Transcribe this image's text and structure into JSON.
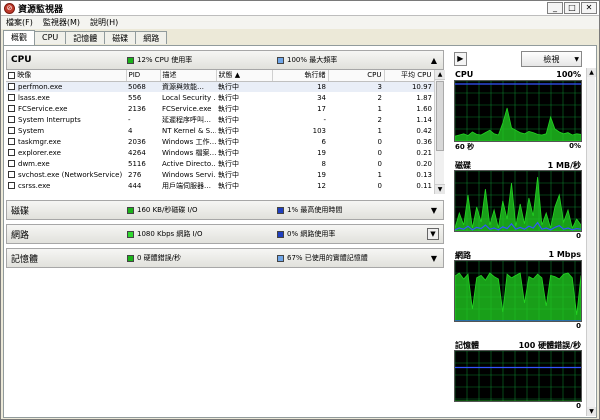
{
  "window": {
    "title": "資源監視器",
    "min": "_",
    "max": "□",
    "close": "✕"
  },
  "menu": [
    "檔案(F)",
    "監視器(M)",
    "說明(H)"
  ],
  "tabs": [
    {
      "label": "概觀",
      "active": true
    },
    {
      "label": "CPU",
      "active": false
    },
    {
      "label": "記憶體",
      "active": false
    },
    {
      "label": "磁碟",
      "active": false
    },
    {
      "label": "網路",
      "active": false
    }
  ],
  "cpu_section": {
    "title": "CPU",
    "stat1": "12% CPU 使用率",
    "stat2": "100% 最大頻率",
    "columns": [
      "映像",
      "PID",
      "描述",
      "狀態",
      "執行緒",
      "CPU",
      "平均 CPU"
    ],
    "rows": [
      {
        "name": "perfmon.exe",
        "pid": "5068",
        "desc": "資源與效能…",
        "status": "執行中",
        "threads": "18",
        "cpu": "3",
        "avg": "10.97"
      },
      {
        "name": "lsass.exe",
        "pid": "556",
        "desc": "Local Security …",
        "status": "執行中",
        "threads": "34",
        "cpu": "2",
        "avg": "1.87"
      },
      {
        "name": "FCService.exe",
        "pid": "2136",
        "desc": "FCService.exe",
        "status": "執行中",
        "threads": "17",
        "cpu": "1",
        "avg": "1.60"
      },
      {
        "name": "System Interrupts",
        "pid": "-",
        "desc": "延遲程序呼叫…",
        "status": "執行中",
        "threads": "-",
        "cpu": "2",
        "avg": "1.14"
      },
      {
        "name": "System",
        "pid": "4",
        "desc": "NT Kernel & S…",
        "status": "執行中",
        "threads": "103",
        "cpu": "1",
        "avg": "0.42"
      },
      {
        "name": "taskmgr.exe",
        "pid": "2036",
        "desc": "Windows 工作…",
        "status": "執行中",
        "threads": "6",
        "cpu": "0",
        "avg": "0.36"
      },
      {
        "name": "explorer.exe",
        "pid": "4264",
        "desc": "Windows 檔案…",
        "status": "執行中",
        "threads": "19",
        "cpu": "0",
        "avg": "0.21"
      },
      {
        "name": "dwm.exe",
        "pid": "5116",
        "desc": "Active Directo…",
        "status": "執行中",
        "threads": "8",
        "cpu": "0",
        "avg": "0.20"
      },
      {
        "name": "svchost.exe (NetworkService)",
        "pid": "276",
        "desc": "Windows Servi…",
        "status": "執行中",
        "threads": "19",
        "cpu": "1",
        "avg": "0.13"
      },
      {
        "name": "csrss.exe",
        "pid": "444",
        "desc": "用戶端伺服器…",
        "status": "執行中",
        "threads": "12",
        "cpu": "0",
        "avg": "0.11"
      }
    ]
  },
  "disk_section": {
    "title": "磁碟",
    "stat1": "160 KB/秒磁碟 I/O",
    "stat2": "1% 最高使用時間"
  },
  "network_section": {
    "title": "網路",
    "stat1": "1080 Kbps 網路 I/O",
    "stat2": "0% 網路使用率"
  },
  "memory_section": {
    "title": "記憶體",
    "stat1": "0 硬體錯誤/秒",
    "stat2": "67% 已使用的實體記憶體"
  },
  "right_panel": {
    "view_label": "檢視",
    "graphs": [
      {
        "name": "CPU",
        "max": "100%",
        "foot_left": "60 秒",
        "foot_right": "0%",
        "green": [
          8,
          10,
          12,
          9,
          15,
          11,
          10,
          14,
          18,
          12,
          10,
          30,
          55,
          22,
          18,
          14,
          12,
          16,
          14,
          11,
          10,
          12,
          40,
          20,
          15,
          12,
          14,
          10,
          12,
          11
        ],
        "blue": [
          95,
          95,
          95,
          95,
          95,
          95,
          95,
          95,
          95,
          95,
          95,
          95,
          95,
          95,
          95,
          95,
          95,
          95,
          95,
          95,
          95,
          95,
          95,
          95,
          95,
          95,
          95,
          95,
          95,
          95
        ]
      },
      {
        "name": "磁碟",
        "max": "1 MB/秒",
        "foot_left": "",
        "foot_right": "0",
        "green": [
          5,
          30,
          10,
          60,
          5,
          40,
          15,
          70,
          10,
          35,
          5,
          50,
          20,
          80,
          8,
          45,
          12,
          55,
          25,
          90,
          10,
          30,
          5,
          40,
          60,
          15,
          35,
          5,
          20,
          10
        ],
        "blue": [
          2,
          5,
          3,
          8,
          2,
          6,
          4,
          10,
          3,
          5,
          2,
          7,
          4,
          12,
          3,
          6,
          3,
          8,
          5,
          14,
          3,
          5,
          2,
          6,
          9,
          3,
          5,
          2,
          4,
          3
        ]
      },
      {
        "name": "網路",
        "max": "1 Mbps",
        "foot_left": "",
        "foot_right": "0",
        "green": [
          75,
          80,
          70,
          78,
          20,
          72,
          76,
          68,
          80,
          74,
          70,
          15,
          78,
          72,
          76,
          80,
          30,
          74,
          70,
          78,
          72,
          25,
          76,
          74,
          70,
          78,
          80,
          72,
          10,
          76
        ],
        "blue": [
          0,
          0,
          0,
          0,
          0,
          0,
          0,
          0,
          0,
          0,
          0,
          0,
          0,
          0,
          0,
          0,
          0,
          0,
          0,
          0,
          0,
          0,
          0,
          0,
          0,
          0,
          0,
          0,
          0,
          0
        ]
      },
      {
        "name": "記憶體",
        "max": "100 硬體錯誤/秒",
        "foot_left": "",
        "foot_right": "0",
        "green": [
          0,
          0,
          0,
          0,
          0,
          0,
          0,
          0,
          0,
          0,
          0,
          0,
          0,
          0,
          0,
          0,
          0,
          0,
          0,
          0,
          0,
          0,
          0,
          0,
          0,
          0,
          0,
          0,
          0,
          0
        ],
        "blue": [
          67,
          67,
          67,
          67,
          67,
          67,
          67,
          67,
          67,
          67,
          67,
          67,
          67,
          67,
          67,
          67,
          67,
          67,
          67,
          67,
          67,
          67,
          67,
          67,
          67,
          67,
          67,
          67,
          67,
          67
        ]
      }
    ]
  },
  "colors": {
    "graph_green": "#22d422",
    "graph_blue": "#3355ff",
    "graph_grid": "#0b7a2a"
  }
}
